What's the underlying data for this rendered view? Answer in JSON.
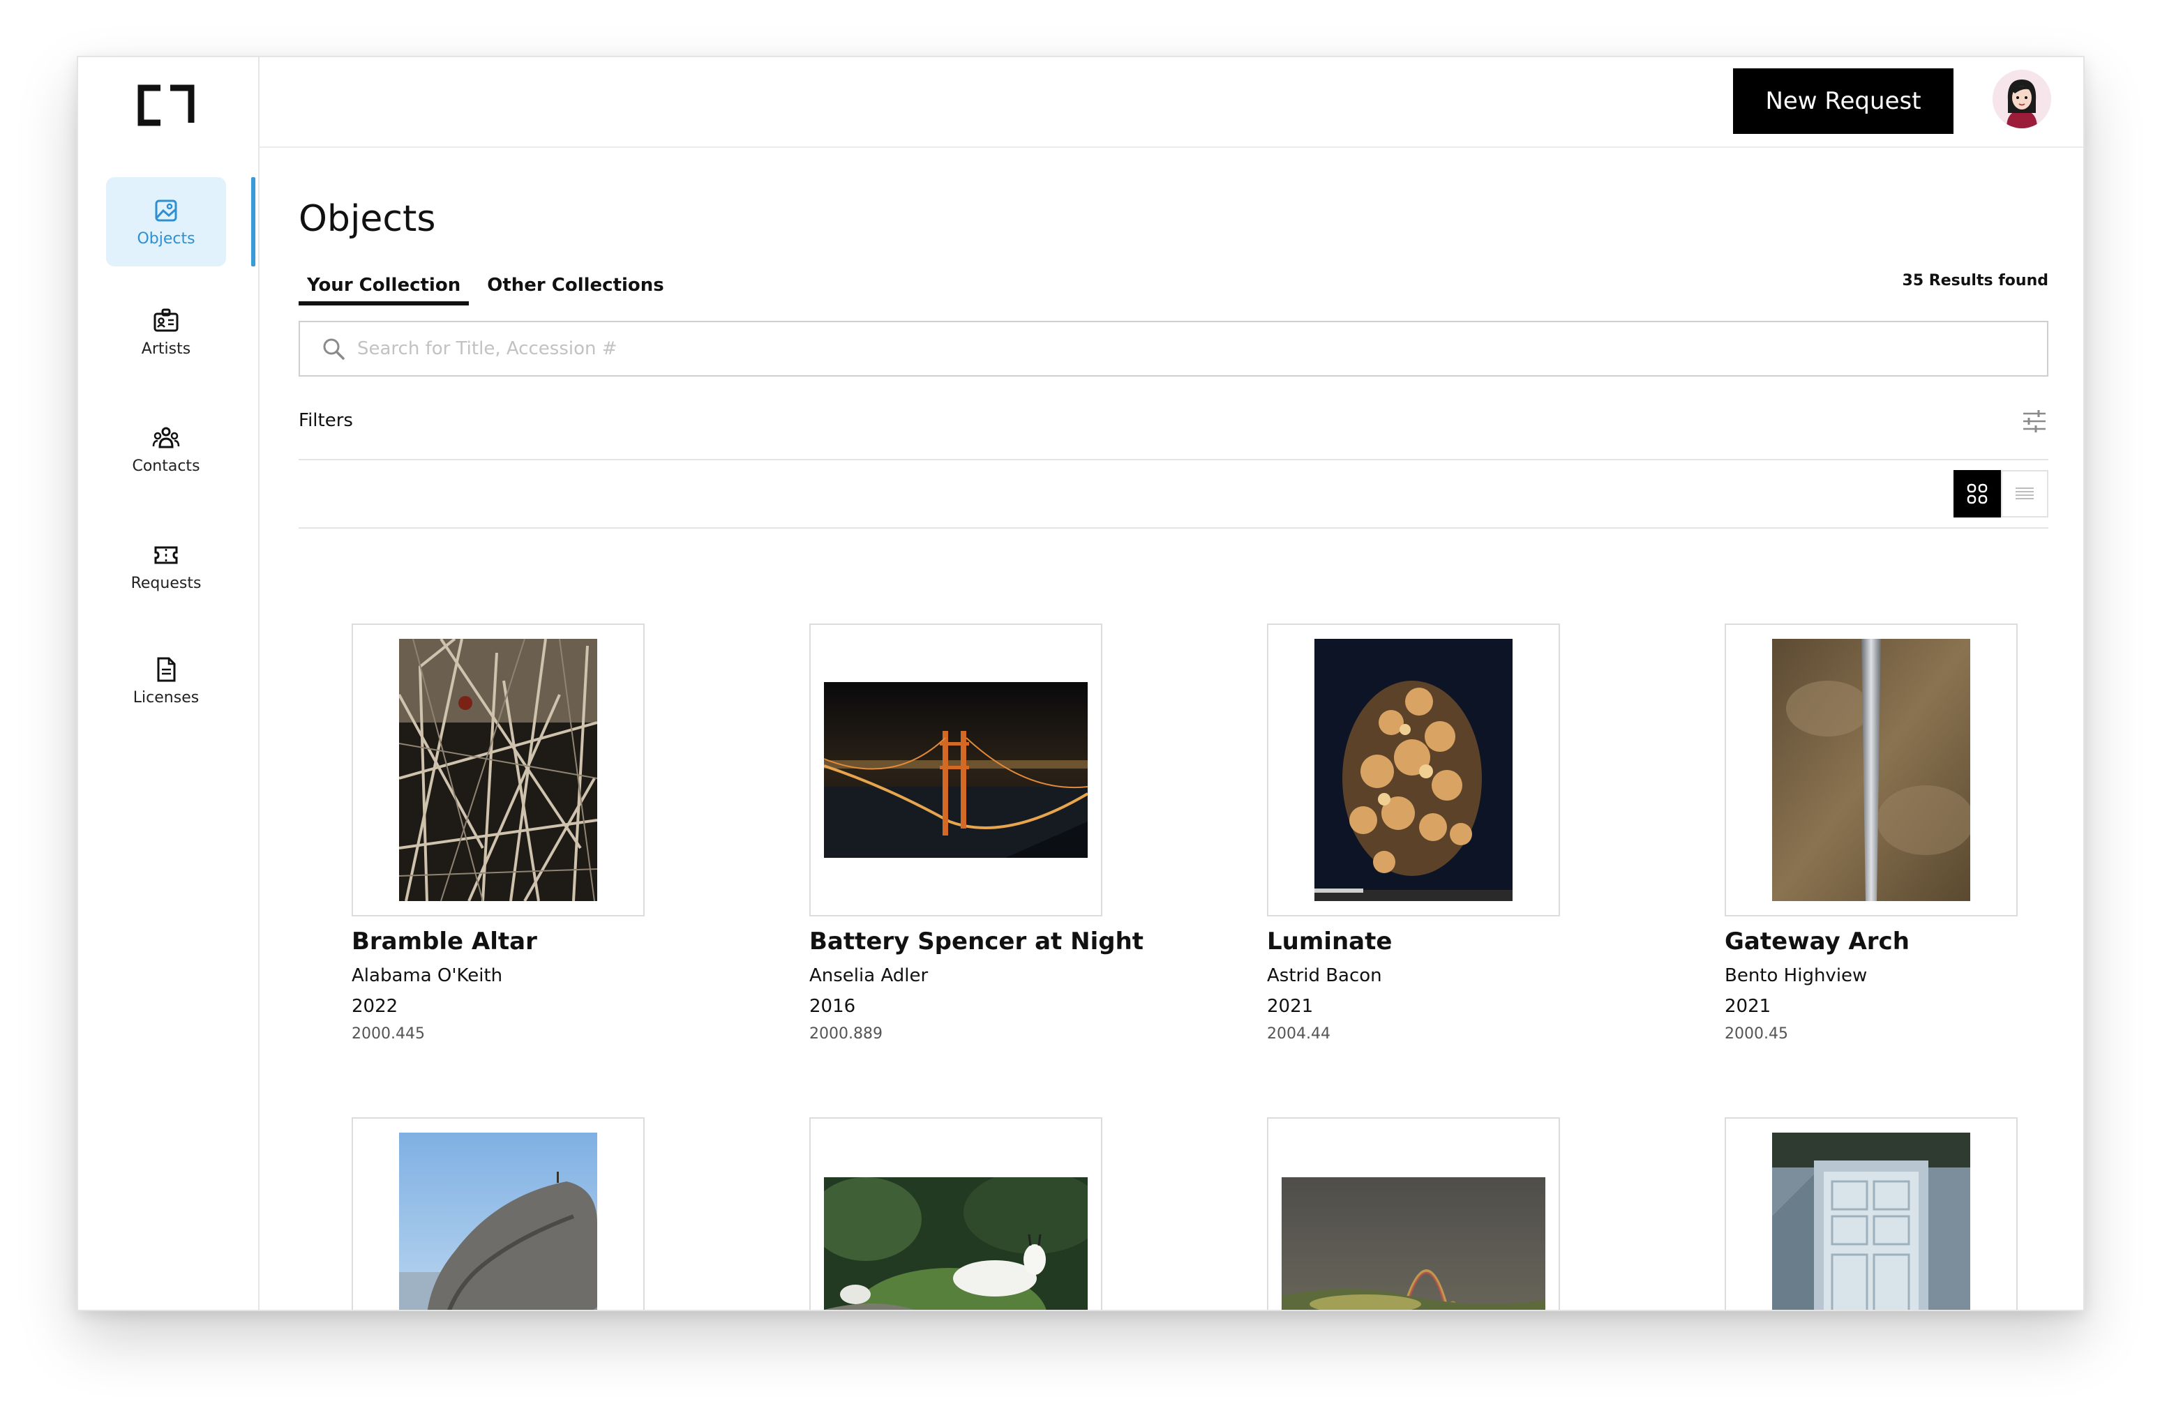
{
  "app": {
    "logo_icon": "bracket-logo-icon",
    "accent_color": "#3b9ad9",
    "active_nav_bg": "#e2f2fc"
  },
  "sidebar": {
    "items": [
      {
        "label": "Objects",
        "icon": "image-icon",
        "active": true
      },
      {
        "label": "Artists",
        "icon": "id-card-icon",
        "active": false
      },
      {
        "label": "Contacts",
        "icon": "people-icon",
        "active": false
      },
      {
        "label": "Requests",
        "icon": "ticket-icon",
        "active": false
      },
      {
        "label": "Licenses",
        "icon": "document-icon",
        "active": false
      }
    ]
  },
  "header": {
    "new_request_label": "New Request",
    "avatar_icon": "user-avatar-icon"
  },
  "main": {
    "title": "Objects",
    "tabs": [
      {
        "label": "Your Collection",
        "active": true
      },
      {
        "label": "Other Collections",
        "active": false
      }
    ],
    "results_text": "35 Results found",
    "search": {
      "placeholder": "Search for Title, Accession #",
      "value": ""
    },
    "filters_label": "Filters",
    "view_modes": [
      "grid-view-icon",
      "list-view-icon"
    ],
    "active_view": "grid"
  },
  "objects": [
    {
      "title": "Bramble Altar",
      "artist": "Alabama O'Keith",
      "year": "2022",
      "accession": "2000.445",
      "image": "bramble-branches-photo"
    },
    {
      "title": "Battery Spencer at Night",
      "artist": "Anselia Adler",
      "year": "2016",
      "accession": "2000.889",
      "image": "golden-gate-night-photo"
    },
    {
      "title": "Luminate",
      "artist": "Astrid Bacon",
      "year": "2021",
      "accession": "2004.44",
      "image": "lit-tree-night-photo"
    },
    {
      "title": "Gateway Arch",
      "artist": "Bento Highview",
      "year": "2021",
      "accession": "2000.45",
      "image": "arch-reflection-photo"
    },
    {
      "image": "rock-cliff-photo"
    },
    {
      "image": "mountain-goat-photo"
    },
    {
      "image": "double-rainbow-photo"
    },
    {
      "image": "white-door-photo"
    }
  ]
}
